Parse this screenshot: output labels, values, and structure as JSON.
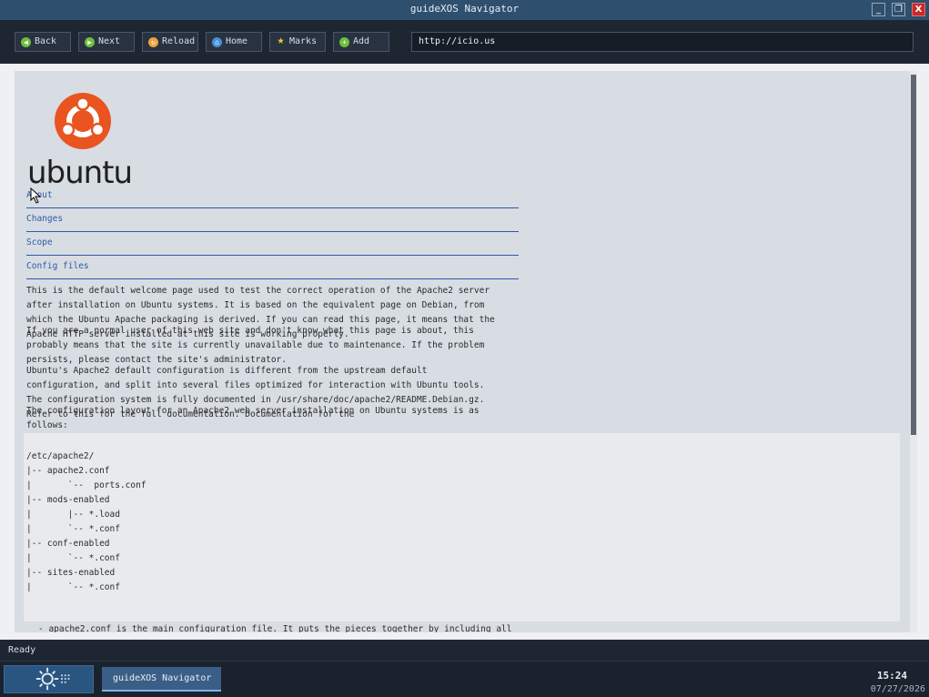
{
  "window": {
    "title": "guideXOS Navigator",
    "minimize_glyph": "_",
    "maximize_glyph": "❐",
    "close_glyph": "X"
  },
  "toolbar": {
    "buttons": [
      {
        "label": "Back",
        "icon": "arrow-left-icon"
      },
      {
        "label": "Next",
        "icon": "arrow-right-icon"
      },
      {
        "label": "Reload",
        "icon": "reload-icon"
      },
      {
        "label": "Home",
        "icon": "home-icon"
      },
      {
        "label": "Marks",
        "icon": "star-icon"
      },
      {
        "label": "Add",
        "icon": "plus-icon"
      }
    ],
    "url_value": "http://icio.us"
  },
  "page": {
    "logo_text": "ubuntu",
    "nav_links": [
      "About",
      "Changes",
      "Scope",
      "Config files"
    ],
    "paragraphs": [
      "This is the default welcome page used to test the correct operation of the Apache2 server\nafter installation on Ubuntu systems. It is based on the equivalent page on Debian, from\nwhich the Ubuntu Apache packaging is derived. If you can read this page, it means that the\nApache HTTP server installed at this site is working properly.",
      "If you are a normal user of this web site and don't know what this page is about, this\nprobably means that the site is currently unavailable due to maintenance. If the problem\npersists, please contact the site's administrator.",
      "Ubuntu's Apache2 default configuration is different from the upstream default\nconfiguration, and split into several files optimized for interaction with Ubuntu tools.\nThe configuration system is fully documented in /usr/share/doc/apache2/README.Debian.gz.\nRefer to this for the full documentation. Documentation for the",
      "The configuration layout for an Apache2 web server installation on Ubuntu systems is as\nfollows:"
    ],
    "code_block": "/etc/apache2/\n|-- apache2.conf\n|       `--  ports.conf\n|-- mods-enabled\n|       |-- *.load\n|       `-- *.conf\n|-- conf-enabled\n|       `-- *.conf\n|-- sites-enabled\n|       `-- *.conf",
    "bullet_line": "-  apache2.conf is the main configuration file. It puts the pieces together by including all"
  },
  "status": {
    "text": "Ready"
  },
  "taskbar": {
    "item_label": "guideXOS Navigator",
    "clock_time": "15:24",
    "clock_date": "07/27/2026"
  },
  "colors": {
    "titlebar": "#2e4f6e",
    "link": "#2c5aa8",
    "ubuntu_orange": "#e95420",
    "close_button": "#c92a2a"
  }
}
